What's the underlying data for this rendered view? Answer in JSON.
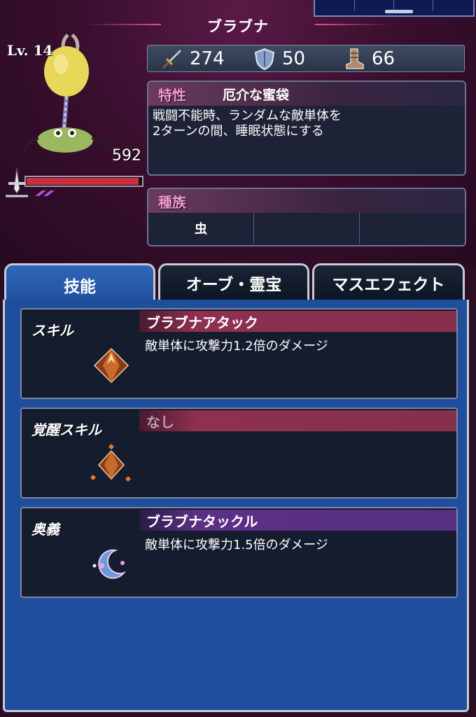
{
  "unit": {
    "name": "ブラブナ",
    "level": "Lv. 14",
    "hp": "592"
  },
  "stats": {
    "attack": "274",
    "defense": "50",
    "speed": "66"
  },
  "trait": {
    "label": "特性",
    "title": "厄介な蜜袋",
    "desc_line1": "戦闘不能時、ランダムな敵単体を",
    "desc_line2": "2ターンの間、睡眠状態にする"
  },
  "race": {
    "label": "種族",
    "cells": [
      "虫",
      "",
      ""
    ]
  },
  "tabs": [
    {
      "label": "技能"
    },
    {
      "label": "オーブ・霊宝"
    },
    {
      "label": "マスエフェクト"
    }
  ],
  "skills": [
    {
      "label": "スキル",
      "name": "ブラブナアタック",
      "desc": "敵単体に攻撃力1.2倍のダメージ"
    },
    {
      "label": "覚醒スキル",
      "name": "なし",
      "desc": ""
    },
    {
      "label": "奥義",
      "name": "ブラブナタックル",
      "desc": "敵単体に攻撃力1.5倍のダメージ"
    }
  ],
  "colors": {
    "accent_pink": "#f39ad0",
    "tab_active": "#2f67b7",
    "skill_bar_red": "#8f3050",
    "skill_bar_purple": "#5c2f86"
  },
  "icons": {
    "attack": "sword-icon",
    "defense": "shield-icon",
    "speed": "boot-icon"
  }
}
